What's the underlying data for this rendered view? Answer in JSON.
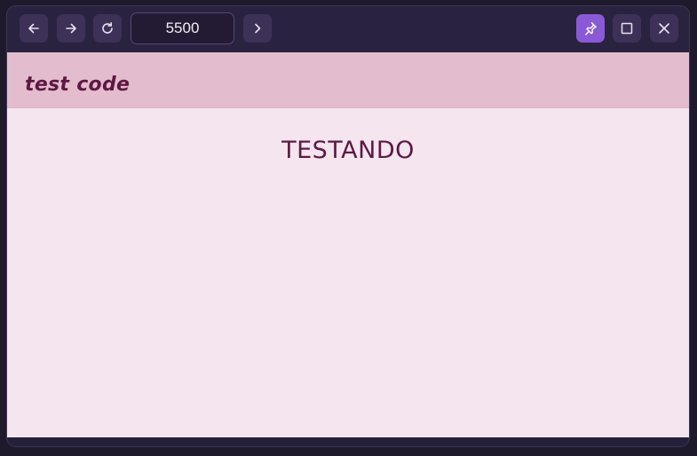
{
  "browser": {
    "address_value": "5500",
    "icons": {
      "back": "arrow-left-icon",
      "forward": "arrow-right-icon",
      "reload": "reload-icon",
      "go": "chevron-right-icon",
      "pin": "pin-icon",
      "maximize": "square-icon",
      "close": "close-icon"
    },
    "colors": {
      "chrome": "#2a2340",
      "button": "#3e3158",
      "accent": "#8a5ad6"
    }
  },
  "page": {
    "header_title": "test code",
    "heading": "TESTANDO",
    "colors": {
      "header_bg": "#e3bdcd",
      "body_bg": "#f4e5ee",
      "text": "#5e1844"
    }
  }
}
